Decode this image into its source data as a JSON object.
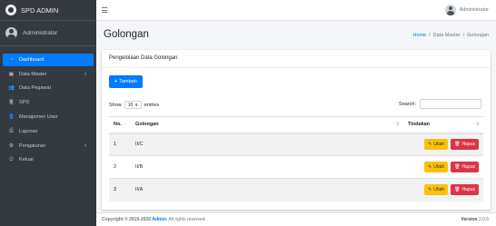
{
  "brand": {
    "title": "SPD ADMIN"
  },
  "user": {
    "name": "Administrator"
  },
  "sidebar": {
    "items": [
      {
        "label": "Dashboard",
        "icon": "tachometer-icon",
        "glyph": "◔",
        "active": true,
        "arrow": ""
      },
      {
        "label": "Data Master",
        "icon": "table-icon",
        "glyph": "▦",
        "active": false,
        "arrow": "‹"
      },
      {
        "label": "Data Pegawai",
        "icon": "users-icon",
        "glyph": "👥",
        "active": false,
        "arrow": ""
      },
      {
        "label": "SPD",
        "icon": "file-icon",
        "glyph": "🗎",
        "active": false,
        "arrow": ""
      },
      {
        "label": "Manajemen User",
        "icon": "user-icon",
        "glyph": "👤",
        "active": false,
        "arrow": ""
      },
      {
        "label": "Laporan",
        "icon": "print-icon",
        "glyph": "⎙",
        "active": false,
        "arrow": ""
      },
      {
        "label": "Pengaturan",
        "icon": "gear-icon",
        "glyph": "⚙",
        "active": false,
        "arrow": "‹"
      },
      {
        "label": "Keluar",
        "icon": "power-icon",
        "glyph": "⏻",
        "active": false,
        "arrow": ""
      }
    ]
  },
  "topbar": {
    "user_name": "Administrator"
  },
  "page": {
    "title": "Golongan",
    "breadcrumb": {
      "home": "Home",
      "sep": "/",
      "mid": "Data Master",
      "current": "Golongan"
    }
  },
  "card": {
    "header": "Pengelolaan Data Golongan",
    "add_button": "Tambah",
    "show_label": "Show",
    "entries_value": "10",
    "entries_label": "entries",
    "search_label": "Search:",
    "search_value": ""
  },
  "table": {
    "columns": [
      "No.",
      "Golongan",
      "Tindakan"
    ],
    "rows": [
      {
        "no": "1",
        "golongan": "II/C"
      },
      {
        "no": "2",
        "golongan": "II/B"
      },
      {
        "no": "3",
        "golongan": "II/A"
      }
    ],
    "edit_label": "Ubah",
    "delete_label": "Hapus"
  },
  "footer": {
    "copyright": "Copyright © 2019-2020",
    "brand": "Admin.",
    "rights": "All rights reserved.",
    "version_label": "Version",
    "version": "3.0.5"
  },
  "colors": {
    "primary": "#007bff",
    "sidebar": "#343a40",
    "warning": "#ffc107",
    "danger": "#dc3545"
  }
}
